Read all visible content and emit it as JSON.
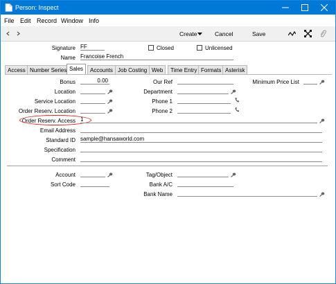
{
  "window": {
    "title": "Person: Inspect"
  },
  "menu": [
    "File",
    "Edit",
    "Record",
    "Window",
    "Info"
  ],
  "toolbar": {
    "create": "Create",
    "cancel": "Cancel",
    "save": "Save"
  },
  "header": {
    "signature_label": "Signature",
    "signature_value": "FF",
    "name_label": "Name",
    "name_value": "Francoise French",
    "closed_label": "Closed",
    "unlicensed_label": "Unlicensed"
  },
  "tabs": [
    "Access",
    "Number Series",
    "Sales",
    "Accounts",
    "Job Costing",
    "Web",
    "Time Entry",
    "Formats",
    "Asterisk"
  ],
  "active_tab": "Sales",
  "form": {
    "bonus_label": "Bonus",
    "bonus_value": "0.00",
    "location_label": "Location",
    "service_location_label": "Service Location",
    "order_reserv_location_label": "Order Reserv. Location",
    "order_reserv_access_label": "Order Reserv. Access",
    "order_reserv_access_value": "1",
    "our_ref_label": "Our Ref",
    "department_label": "Department",
    "phone1_label": "Phone 1",
    "phone2_label": "Phone 2",
    "min_price_list_label": "Minimum Price List",
    "email_label": "Email Address",
    "standard_id_label": "Standard ID",
    "standard_id_value": "sample@hansaworld.com",
    "specification_label": "Specification",
    "comment_label": "Comment",
    "account_label": "Account",
    "sort_code_label": "Sort Code",
    "tag_object_label": "Tag/Object",
    "bank_ac_label": "Bank A/C",
    "bank_name_label": "Bank Name"
  },
  "colors": {
    "titlebar": "#0078d7",
    "highlight_oval": "#e02020"
  }
}
